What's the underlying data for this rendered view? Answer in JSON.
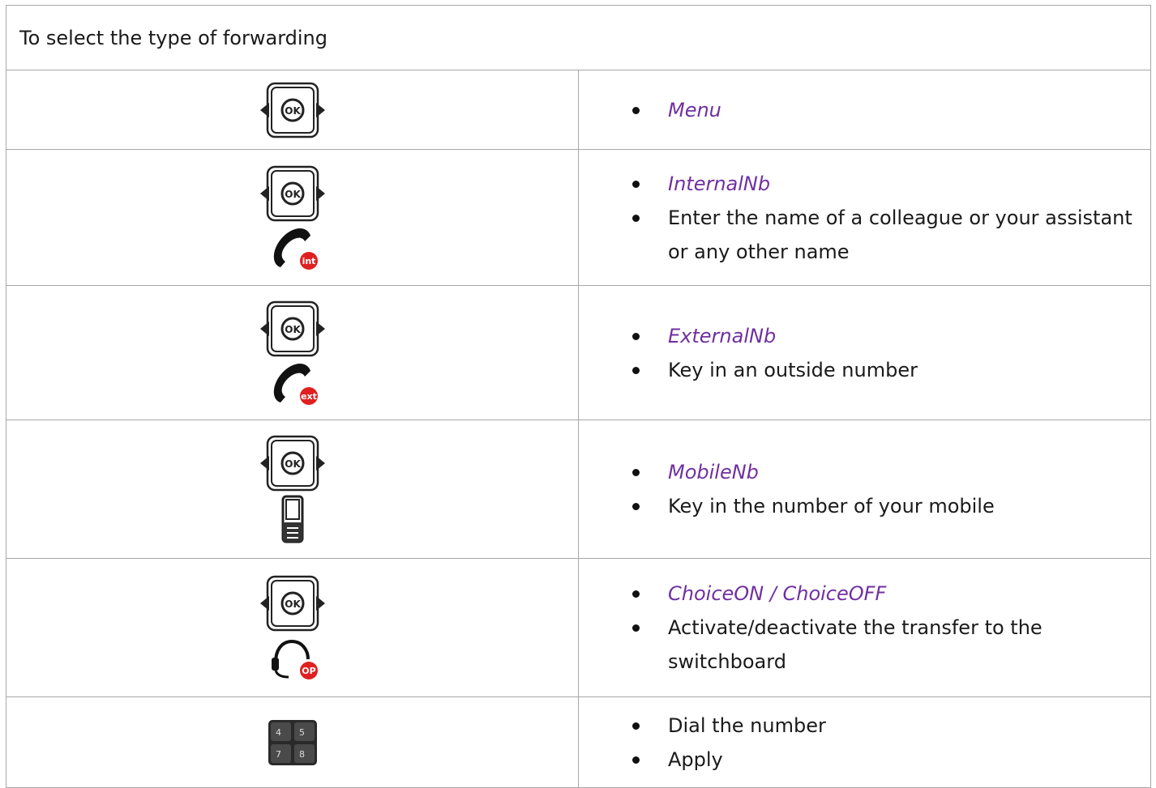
{
  "header": {
    "title": "To select the type of forwarding"
  },
  "rows": [
    {
      "icons": [
        "ok-navigation-icon"
      ],
      "items": [
        {
          "text": "Menu",
          "menu": true
        }
      ]
    },
    {
      "icons": [
        "ok-navigation-icon",
        "internal-call-icon"
      ],
      "badge": "int",
      "items": [
        {
          "text": "InternalNb",
          "menu": true
        },
        {
          "text": "Enter the name of a colleague or your assistant or any other name",
          "menu": false
        }
      ]
    },
    {
      "icons": [
        "ok-navigation-icon",
        "external-call-icon"
      ],
      "badge": "ext",
      "items": [
        {
          "text": "ExternalNb",
          "menu": true
        },
        {
          "text": "Key in an outside number",
          "menu": false
        }
      ]
    },
    {
      "icons": [
        "ok-navigation-icon",
        "mobile-phone-icon"
      ],
      "items": [
        {
          "text": "MobileNb",
          "menu": true
        },
        {
          "text": "Key in the number of your mobile",
          "menu": false
        }
      ]
    },
    {
      "icons": [
        "ok-navigation-icon",
        "operator-headset-icon"
      ],
      "badge": "OP",
      "items": [
        {
          "text": "ChoiceON / ChoiceOFF",
          "menu": true
        },
        {
          "text": "Activate/deactivate the transfer to the switchboard",
          "menu": false
        }
      ]
    },
    {
      "icons": [
        "keypad-icon"
      ],
      "keypad": [
        "4",
        "5",
        "7",
        "8"
      ],
      "items": [
        {
          "text": "Dial the number",
          "menu": false
        },
        {
          "text": "Apply",
          "menu": false
        }
      ]
    }
  ],
  "colors": {
    "menu_text": "#7030a0",
    "badge_red": "#e02020",
    "border": "#a7a7a7"
  },
  "ok_label": "OK"
}
